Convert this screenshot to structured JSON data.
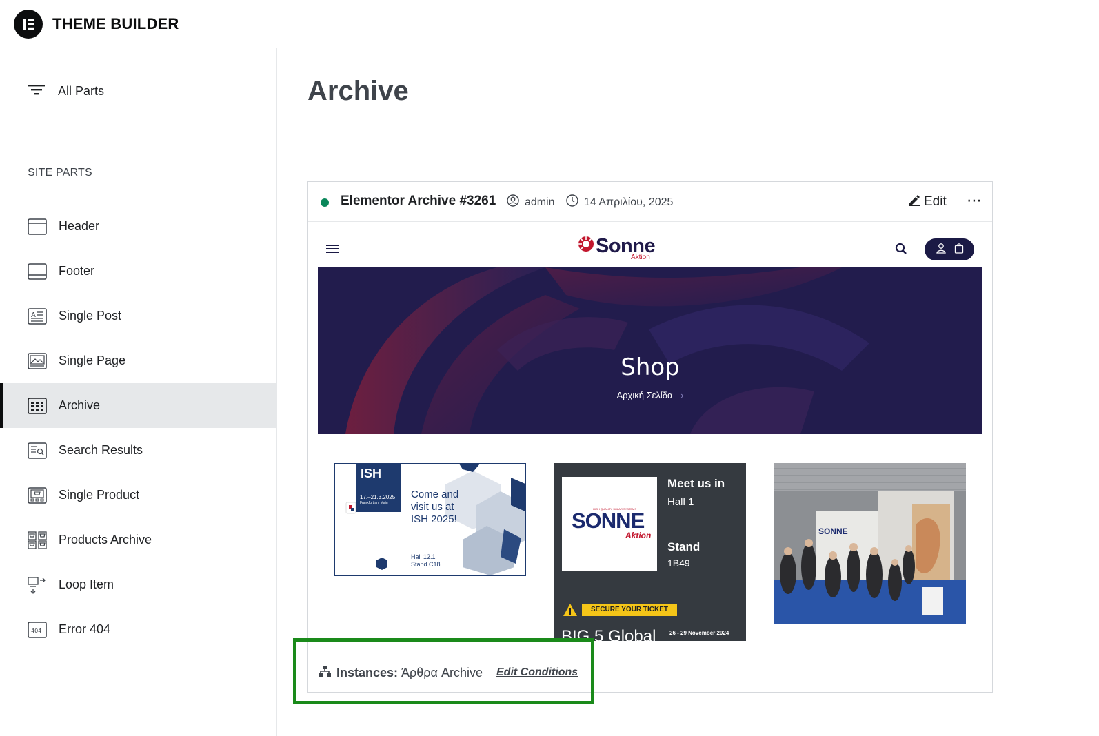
{
  "app": {
    "title": "THEME BUILDER"
  },
  "sidebar": {
    "all_parts_label": "All Parts",
    "section_label": "SITE PARTS",
    "items": [
      {
        "label": "Header",
        "icon": "header-icon"
      },
      {
        "label": "Footer",
        "icon": "footer-icon"
      },
      {
        "label": "Single Post",
        "icon": "single-post-icon"
      },
      {
        "label": "Single Page",
        "icon": "single-page-icon"
      },
      {
        "label": "Archive",
        "icon": "archive-icon",
        "active": true
      },
      {
        "label": "Search Results",
        "icon": "search-results-icon"
      },
      {
        "label": "Single Product",
        "icon": "single-product-icon"
      },
      {
        "label": "Products Archive",
        "icon": "products-archive-icon"
      },
      {
        "label": "Loop Item",
        "icon": "loop-item-icon"
      },
      {
        "label": "Error 404",
        "icon": "error-404-icon"
      }
    ]
  },
  "main": {
    "title": "Archive",
    "card": {
      "name": "Elementor Archive #3261",
      "status_color": "#0a875a",
      "author": "admin",
      "date": "14 Απριλίου, 2025",
      "edit_label": "Edit",
      "more_label": "⋯",
      "preview": {
        "logo_text": "Sonne",
        "logo_sub": "Aktion",
        "hero_title": "Shop",
        "hero_breadcrumb": "Αρχική Σελίδα",
        "hero_chevron": "›",
        "tile1": {
          "brand": "ISH",
          "dates": "17.–21.3.2025",
          "city": "Frankfurt am Main",
          "line1": "Come and",
          "line2": "visit us at",
          "line3": "ISH 2025!",
          "hall": "Hall 12.1",
          "stand": "Stand C18"
        },
        "tile2": {
          "heading": "Meet us in",
          "hall": "Hall 1",
          "stand_label": "Stand",
          "stand": "1B49",
          "logo": "SONNE",
          "logo_sub": "Aktion",
          "logo_top": "HIGH QUALITY SOLAR SYSTEMS",
          "ticket": "SECURE YOUR TICKET",
          "dates": "26 - 29 November 2024",
          "event": "BIG 5 Global"
        },
        "tile3": {
          "sign": "SONNE"
        }
      },
      "instances_label": "Instances:",
      "instances_value": "Άρθρα Archive",
      "edit_conditions_label": "Edit Conditions"
    }
  },
  "colors": {
    "accent": "#0c0d0e",
    "highlight": "#1a8a1a",
    "hero": "#221c4d",
    "brand_red": "#c2162d"
  }
}
